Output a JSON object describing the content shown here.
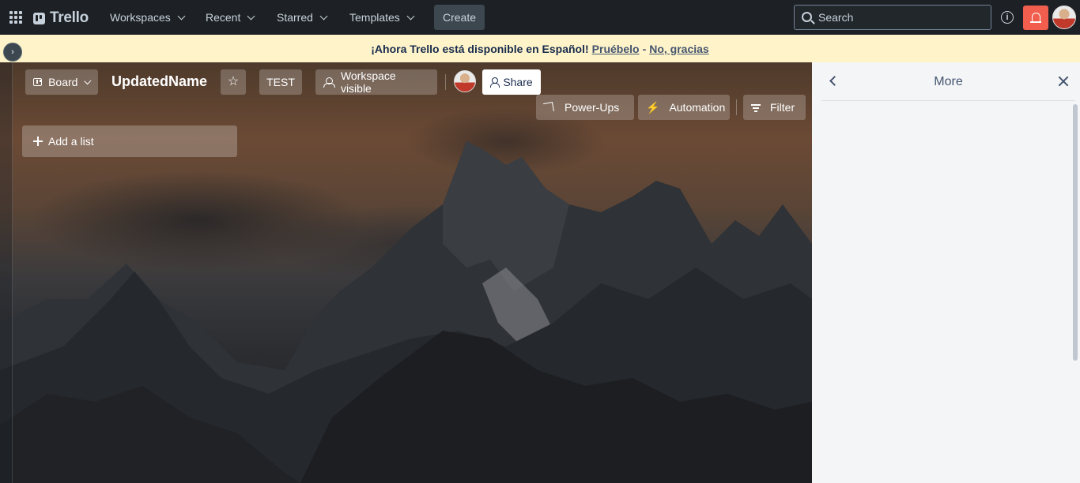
{
  "topnav": {
    "brand": "Trello",
    "menus": [
      {
        "label": "Workspaces"
      },
      {
        "label": "Recent"
      },
      {
        "label": "Starred"
      },
      {
        "label": "Templates"
      }
    ],
    "create_label": "Create",
    "search_placeholder": "Search",
    "icons": [
      "apps-icon",
      "info-icon",
      "bell-icon"
    ]
  },
  "banner": {
    "message": "¡Ahora Trello está disponible en Español!",
    "try_link": "Pruébelo",
    "separator": "-",
    "dismiss_link": "No, gracias"
  },
  "board": {
    "view_label": "Board",
    "name": "UpdatedName",
    "workspace_tag": "TEST",
    "visibility_label": "Workspace visible",
    "share_label": "Share",
    "powerups_label": "Power-Ups",
    "automation_label": "Automation",
    "filter_label": "Filter",
    "add_list_label": "Add a list"
  },
  "panel": {
    "title": "More"
  },
  "colors": {
    "nav_bg": "#1d2125",
    "banner_bg": "#fff4c9",
    "notification": "#f15e4e",
    "panel_bg": "#f4f5f7"
  }
}
